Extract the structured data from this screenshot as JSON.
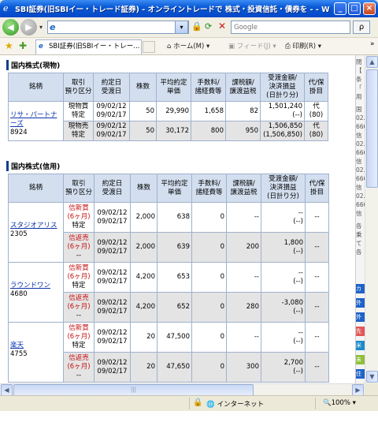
{
  "window": {
    "title": "SBI証券(旧SBIイー・トレード証券) - オンライントレードで 株式・投資信託・債券を - - Wind...",
    "min": "_",
    "max": "□",
    "close": "×"
  },
  "nav": {
    "search_placeholder": "Google",
    "search_go": "ρ"
  },
  "tabs": {
    "active_tab": "SBI証券(旧SBIイー・トレー...",
    "home": "ホーム(M)",
    "feed": "フィード(J)",
    "print": "印刷(R)"
  },
  "cash": {
    "section_title": "国内株式(現物)",
    "headers": [
      "銘柄",
      "取引\n預り区分",
      "約定日\n受渡日",
      "株数",
      "平均約定\n単価",
      "手数料/\n諸経費等",
      "課税額/\n譲渡益税",
      "受渡金額/\n決済損益\n(日計り分)",
      "代/保\n掛目"
    ],
    "rows": [
      {
        "name": "リサ・パートナーズ",
        "code": "8924",
        "sub": [
          {
            "type": "現物買",
            "acct": "特定",
            "date1": "09/02/12",
            "date2": "09/02/17",
            "qty": "50",
            "price": "29,990",
            "fee": "1,658",
            "tax": "82",
            "amt1": "1,501,240",
            "amt2": "(--)",
            "margin1": "代",
            "margin2": "(80)"
          },
          {
            "type": "現物売",
            "acct": "特定",
            "date1": "09/02/12",
            "date2": "09/02/17",
            "qty": "50",
            "price": "30,172",
            "fee": "800",
            "tax": "950",
            "amt1": "1,506,850",
            "amt2": "(1,506,850)",
            "margin1": "代",
            "margin2": "(80)"
          }
        ]
      }
    ]
  },
  "margin": {
    "section_title": "国内株式(信用)",
    "headers": [
      "銘柄",
      "取引\n預り区分",
      "約定日\n受渡日",
      "株数",
      "平均約定\n単価",
      "手数料/\n諸経費等",
      "課税額/\n譲渡益税",
      "受渡金額/\n決済損益\n(日計り分)",
      "代/保\n掛目"
    ],
    "rows": [
      {
        "name": "スタジオアリス",
        "code": "2305",
        "sub": [
          {
            "type": "信新買(6ヶ月)",
            "acct": "特定",
            "date1": "09/02/12",
            "date2": "09/02/17",
            "qty": "2,000",
            "price": "638",
            "fee": "0",
            "tax": "--",
            "amt1": "--",
            "amt2": "(--)",
            "margin": "--"
          },
          {
            "type": "信返売(6ヶ月)",
            "acct": "--",
            "date1": "09/02/12",
            "date2": "09/02/17",
            "qty": "2,000",
            "price": "639",
            "fee": "0",
            "tax": "200",
            "amt1": "1,800",
            "amt2": "(--)",
            "margin": "--"
          }
        ]
      },
      {
        "name": "ラウンドワン",
        "code": "4680",
        "sub": [
          {
            "type": "信新買(6ヶ月)",
            "acct": "特定",
            "date1": "09/02/12",
            "date2": "09/02/17",
            "qty": "4,200",
            "price": "653",
            "fee": "0",
            "tax": "--",
            "amt1": "--",
            "amt2": "(--)",
            "margin": "--"
          },
          {
            "type": "信返売(6ヶ月)",
            "acct": "--",
            "date1": "09/02/12",
            "date2": "09/02/17",
            "qty": "4,200",
            "price": "652",
            "fee": "0",
            "tax": "280",
            "amt1": "-3,080",
            "amt2": "(--)",
            "margin": "--"
          }
        ]
      },
      {
        "name": "楽天",
        "code": "4755",
        "sub": [
          {
            "type": "信新買(6ヶ月)",
            "acct": "特定",
            "date1": "09/02/12",
            "date2": "09/02/17",
            "qty": "20",
            "price": "47,500",
            "fee": "0",
            "tax": "--",
            "amt1": "--",
            "amt2": "(--)",
            "margin": "--"
          },
          {
            "type": "信返売(6ヶ月)",
            "acct": "--",
            "date1": "09/02/12",
            "date2": "09/02/17",
            "qty": "20",
            "price": "47,650",
            "fee": "0",
            "tax": "300",
            "amt1": "2,700",
            "amt2": "(--)",
            "margin": "--"
          }
        ]
      }
    ]
  },
  "right_strip": {
    "items": [
      "閉",
      "【",
      "条",
      "「",
      "用",
      "国",
      "02.",
      "666",
      "信",
      "02.",
      "666",
      "信",
      "02.",
      "666",
      "信",
      "02.",
      "666",
      "信",
      "各",
      "乗",
      "て",
      "各"
    ],
    "boxes": [
      {
        "label": "カ",
        "color": "#1f63c8"
      },
      {
        "label": "外",
        "color": "#1f63c8"
      },
      {
        "label": "外",
        "color": "#1f63c8"
      },
      {
        "label": "先",
        "color": "#e05858"
      },
      {
        "label": "米",
        "color": "#1f8ac8"
      },
      {
        "label": "未",
        "color": "#8fbf3a"
      },
      {
        "label": "住",
        "color": "#1f63c8"
      }
    ]
  },
  "status": {
    "zone": "インターネット",
    "zoom": "100%"
  }
}
